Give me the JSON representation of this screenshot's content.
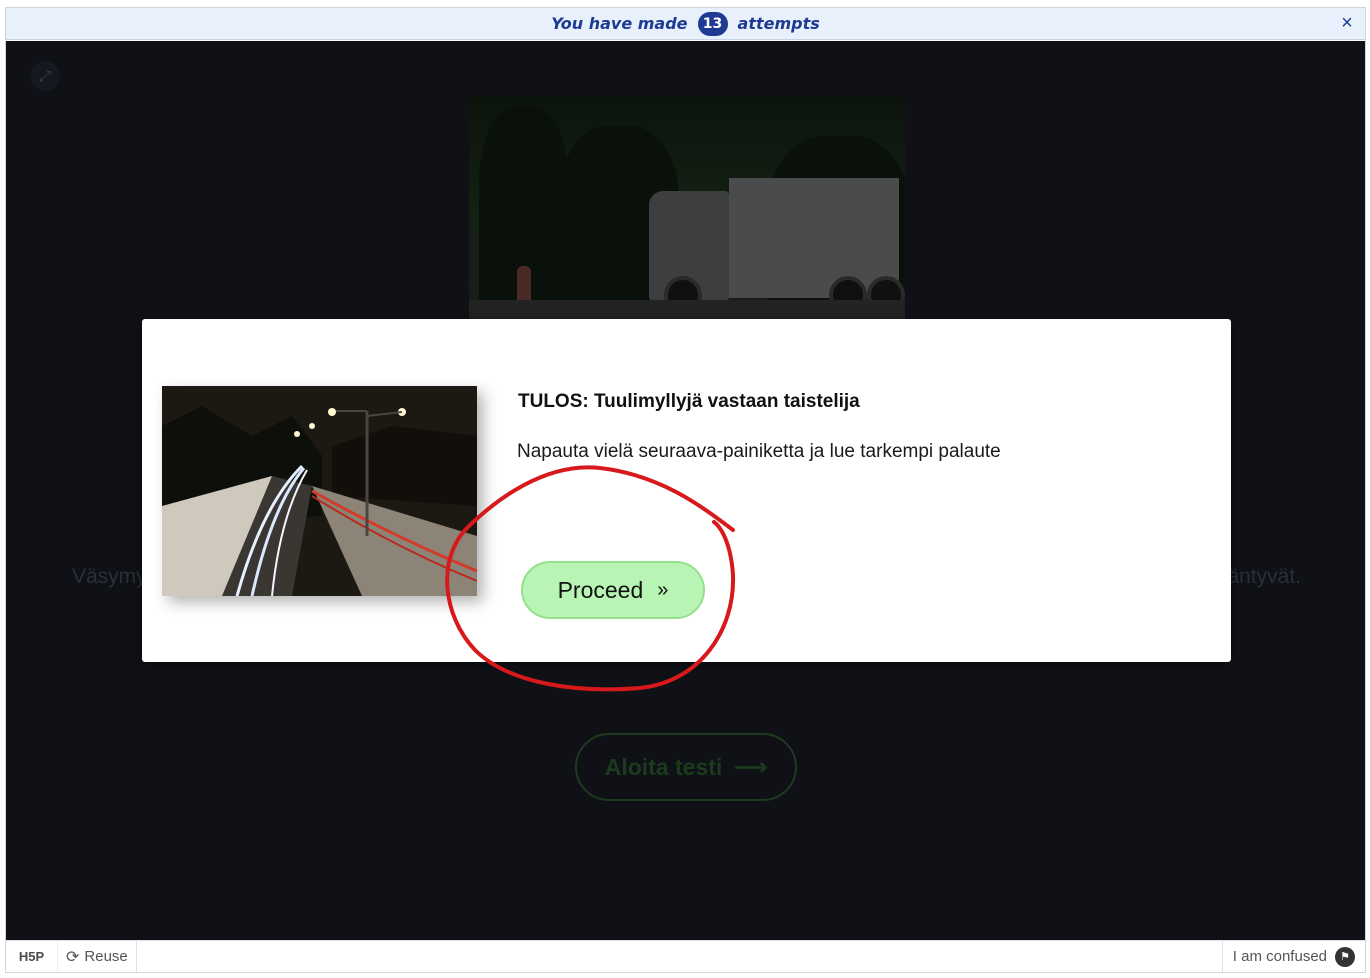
{
  "attempts_bar": {
    "prefix": "You have made",
    "count": "13",
    "suffix": "attempts",
    "close_icon": "×"
  },
  "background": {
    "text_left": "Väsymy",
    "text_right": "äntyvät.",
    "start_button_label": "Aloita testi",
    "start_button_icon": "⟶"
  },
  "modal": {
    "title": "TULOS: Tuulimyllyjä vastaan taistelija",
    "body": "Napauta vielä seuraava-painiketta ja lue tarkempi palaute",
    "proceed_label": "Proceed",
    "proceed_icon": "»"
  },
  "footer": {
    "logo": "H5P",
    "reuse_label": "Reuse",
    "confused_label": "I am confused"
  },
  "colors": {
    "accent": "#1f3a93",
    "proceed_bg": "#b8f5b4",
    "annotation": "#d7191c"
  }
}
